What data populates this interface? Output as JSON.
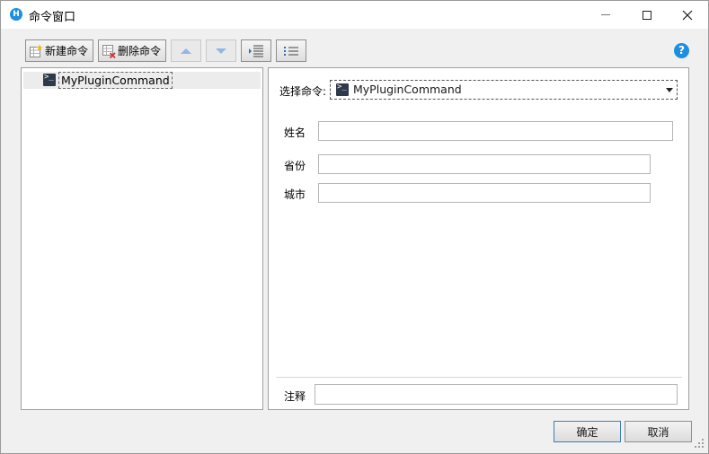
{
  "window": {
    "title": "命令窗口",
    "app_icon_letter": "H"
  },
  "toolbar": {
    "new_command_label": "新建命令",
    "delete_command_label": "删除命令"
  },
  "tree": {
    "items": [
      {
        "label": "MyPluginCommand",
        "icon": "terminal-icon"
      }
    ]
  },
  "form": {
    "select_command_label": "选择命令:",
    "select_command_value": "MyPluginCommand",
    "fields": [
      {
        "label": "姓名",
        "value": ""
      },
      {
        "label": "省份",
        "value": ""
      },
      {
        "label": "城市",
        "value": ""
      }
    ],
    "comment_label": "注释",
    "comment_value": ""
  },
  "buttons": {
    "ok_label": "确定",
    "cancel_label": "取消"
  },
  "colors": {
    "accent": "#1e8fe0",
    "panel_border": "#a0a0a0",
    "window_bg": "#f0f0f0"
  }
}
